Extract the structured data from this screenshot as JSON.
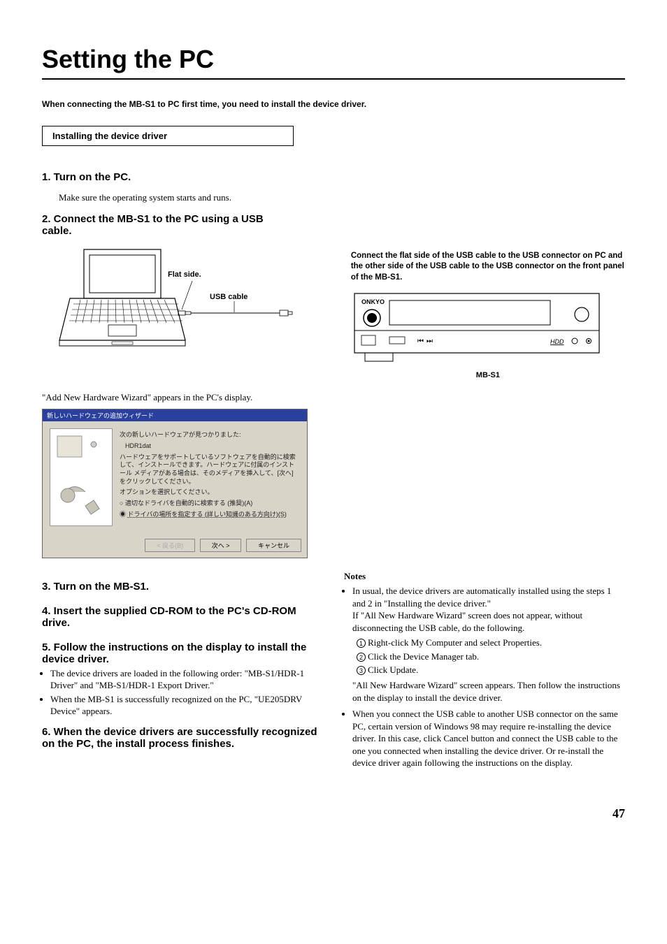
{
  "title": "Setting the PC",
  "intro": "When connecting the MB-S1 to PC first time, you need to install the device driver.",
  "section_box": "Installing the device driver",
  "steps": {
    "s1_heading": "1. Turn on the PC.",
    "s1_sub": "Make sure the operating system starts and runs.",
    "s2_heading": "2. Connect the MB-S1 to the PC using a USB cable.",
    "s2_right_note": "Connect the flat side of the USB cable to the USB connector on PC and the other side of the USB cable to the USB connector on the front panel of the MB-S1.",
    "s2_fig_flat": "Flat side.",
    "s2_fig_cable": "USB cable",
    "s2_fig_onkyo": "ONKYO",
    "s2_fig_hdd": "HDD",
    "s2_fig_caption": "MB-S1",
    "s2_after": "\"Add New Hardware Wizard\" appears in the PC's display.",
    "s3_heading": "3. Turn on the MB-S1.",
    "s4_heading": "4. Insert the supplied CD-ROM to the PC's CD-ROM drive.",
    "s5_heading": "5. Follow the instructions on the display to install the device driver.",
    "s5_b1": "The device drivers are loaded in the following order: \"MB-S1/HDR-1 Driver\" and \"MB-S1/HDR-1 Export Driver.\"",
    "s5_b2": "When the MB-S1 is successfully recognized on the PC, \"UE205DRV Device\" appears.",
    "s6_heading": "6. When the device drivers are successfully recognized on the PC, the install process finishes."
  },
  "wizard": {
    "title": "新しいハードウェアの追加ウィザード",
    "line1": "次の新しいハードウェアが見つかりました:",
    "line2": "HDR1dat",
    "line3": "ハードウェアをサポートしているソフトウェアを自動的に検索して、インストールできます。ハードウェアに付属のインストール メディアがある場合は、そのメディアを挿入して、[次へ] をクリックしてください。",
    "line4": "オプションを選択してください。",
    "opt1": "適切なドライバを自動的に検索する (推奨)(A)",
    "opt2": "ドライバの場所を指定する (詳しい知識のある方向け)(S)",
    "btn_back": "< 戻る(B)",
    "btn_next": "次へ >",
    "btn_cancel": "キャンセル"
  },
  "notes": {
    "heading": "Notes",
    "n1_a": "In usual, the device drivers are automatically installed using the steps 1 and 2 in \"Installing the device driver.\"",
    "n1_b": "If \"All New Hardware Wizard\" screen does not appear, without disconnecting the USB cable, do the following.",
    "sub1": "Right-click My Computer and select Properties.",
    "sub2": "Click the Device Manager tab.",
    "sub3": "Click Update.",
    "n1_c": "\"All New Hardware Wizard\" screen appears. Then follow the instructions on the display to install the device driver.",
    "n2": "When you connect the USB cable to another USB connector on the same PC, certain version of Windows 98 may require re-installing the device driver. In this case, click Cancel button and connect the USB cable to the one you connected when installing the device driver. Or re-install the device driver again following the instructions on the display."
  },
  "page_number": "47"
}
